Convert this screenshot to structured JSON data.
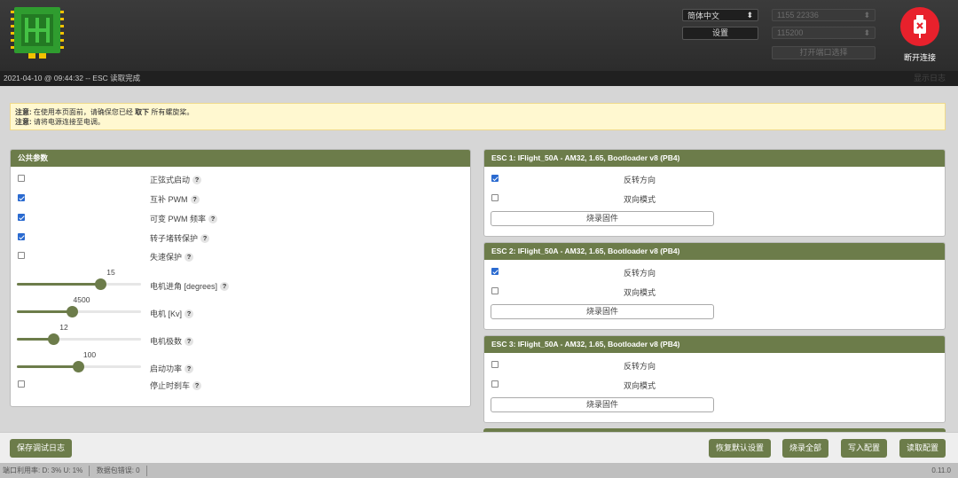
{
  "header": {
    "language": "简体中文",
    "settings_label": "设置",
    "port": "1155 22336",
    "baud": "115200",
    "open_port_label": "打开端口选择",
    "disconnect_label": "断开连接"
  },
  "log": {
    "message": "2021-04-10 @ 09:44:32 -- ESC 读取完成",
    "show_log_label": "显示日志"
  },
  "notice": {
    "line1_prefix": "注意:",
    "line1_text": "在使用本页面前，请确保您已经",
    "line1_bold": "取下",
    "line1_suffix": "所有螺旋桨。",
    "line2_prefix": "注意:",
    "line2_text": "请将电源连接至电调。"
  },
  "common": {
    "title": "公共参数",
    "checkboxes": [
      {
        "label": "正弦式启动",
        "checked": false
      },
      {
        "label": "互补 PWM",
        "checked": true
      },
      {
        "label": "可变 PWM 频率",
        "checked": true
      },
      {
        "label": "转子堵转保护",
        "checked": true
      },
      {
        "label": "失速保护",
        "checked": false
      }
    ],
    "sliders": [
      {
        "label": "电机进角 [degrees]",
        "value": "15",
        "level": 0.67
      },
      {
        "label": "电机 [Kv]",
        "value": "4500",
        "level": 0.44
      },
      {
        "label": "电机极数",
        "value": "12",
        "level": 0.29
      },
      {
        "label": "启动功率",
        "value": "100",
        "level": 0.49
      }
    ],
    "brake": {
      "label": "停止时刹车",
      "checked": false
    }
  },
  "escs": [
    {
      "title": "ESC 1: IFlight_50A - AM32, 1.65, Bootloader v8 (PB4)",
      "reverse_label": "反转方向",
      "reverse": true,
      "bidir_label": "双向模式",
      "bidir": false,
      "flash_label": "烧录固件"
    },
    {
      "title": "ESC 2: IFlight_50A - AM32, 1.65, Bootloader v8 (PB4)",
      "reverse_label": "反转方向",
      "reverse": true,
      "bidir_label": "双向模式",
      "bidir": false,
      "flash_label": "烧录固件"
    },
    {
      "title": "ESC 3: IFlight_50A - AM32, 1.65, Bootloader v8 (PB4)",
      "reverse_label": "反转方向",
      "reverse": false,
      "bidir_label": "双向模式",
      "bidir": false,
      "flash_label": "烧录固件"
    }
  ],
  "toolbar": {
    "save_log": "保存调试日志",
    "restore_defaults": "恢复默认设置",
    "flash_all": "烧录全部",
    "write_config": "写入配置",
    "read_config": "读取配置"
  },
  "status": {
    "port_usage": "端口利用率:  D: 3% U: 1%",
    "packet_errors": "数据包错误: 0",
    "version": "0.11.0"
  },
  "colors": {
    "accent": "#6c7c4a",
    "disconnect": "#e8212c",
    "checkbox": "#2a6ad0"
  }
}
